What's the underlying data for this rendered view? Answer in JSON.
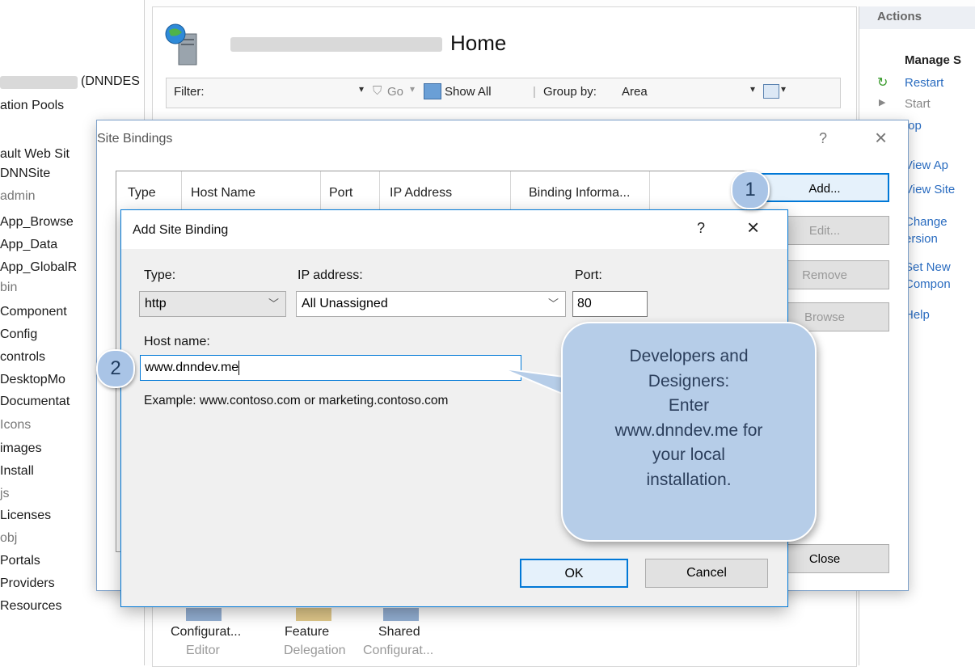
{
  "main": {
    "title": "Home",
    "filter_label": "Filter:",
    "go_label": "Go",
    "show_all_label": "Show All",
    "group_by_label": "Group by:",
    "group_by_value": "Area"
  },
  "tree": {
    "server_suffix": "(DNNDES",
    "items": [
      "ation Pools",
      "ault Web Sit",
      "DNNSite",
      "admin",
      "App_Browse",
      "App_Data",
      "App_GlobalR",
      "bin",
      "Component",
      "Config",
      "controls",
      "DesktopMo",
      "Documentat",
      "Icons",
      "images",
      "Install",
      "js",
      "Licenses",
      "obj",
      "Portals",
      "Providers",
      "Resources"
    ]
  },
  "actions": {
    "header": "Actions",
    "manage": "Manage S",
    "items": [
      "Restart",
      "Start",
      "top",
      "View Ap",
      "View Site",
      "Change",
      "ersion",
      "Set New",
      "Compon",
      "Help"
    ]
  },
  "site_bindings": {
    "title": "Site Bindings",
    "help": "?",
    "close": "×",
    "columns": [
      "Type",
      "Host Name",
      "Port",
      "IP Address",
      "Binding Informa..."
    ],
    "buttons": {
      "add": "Add...",
      "edit": "Edit...",
      "remove": "Remove",
      "browse": "Browse",
      "close": "Close"
    }
  },
  "add_binding": {
    "title": "Add Site Binding",
    "help": "?",
    "close": "×",
    "type_label": "Type:",
    "type_value": "http",
    "ip_label": "IP address:",
    "ip_value": "All Unassigned",
    "port_label": "Port:",
    "port_value": "80",
    "host_label": "Host name:",
    "host_value": "www.dnndev.me",
    "example": "Example: www.contoso.com or marketing.contoso.com",
    "ok": "OK",
    "cancel": "Cancel"
  },
  "annotations": {
    "step1": "1",
    "step2": "2",
    "callout": "Developers and\nDesigners:\nEnter\nwww.dnndev.me for\nyour local\ninstallation."
  },
  "bottom_features": [
    {
      "label": "Configurat...",
      "sub": "Editor"
    },
    {
      "label": "Feature",
      "sub": "Delegation"
    },
    {
      "label": "Shared",
      "sub": "Configurat..."
    }
  ],
  "colors": {
    "accent": "#0078d7",
    "callout": "#b6cde8",
    "link": "#2a6cc0"
  }
}
